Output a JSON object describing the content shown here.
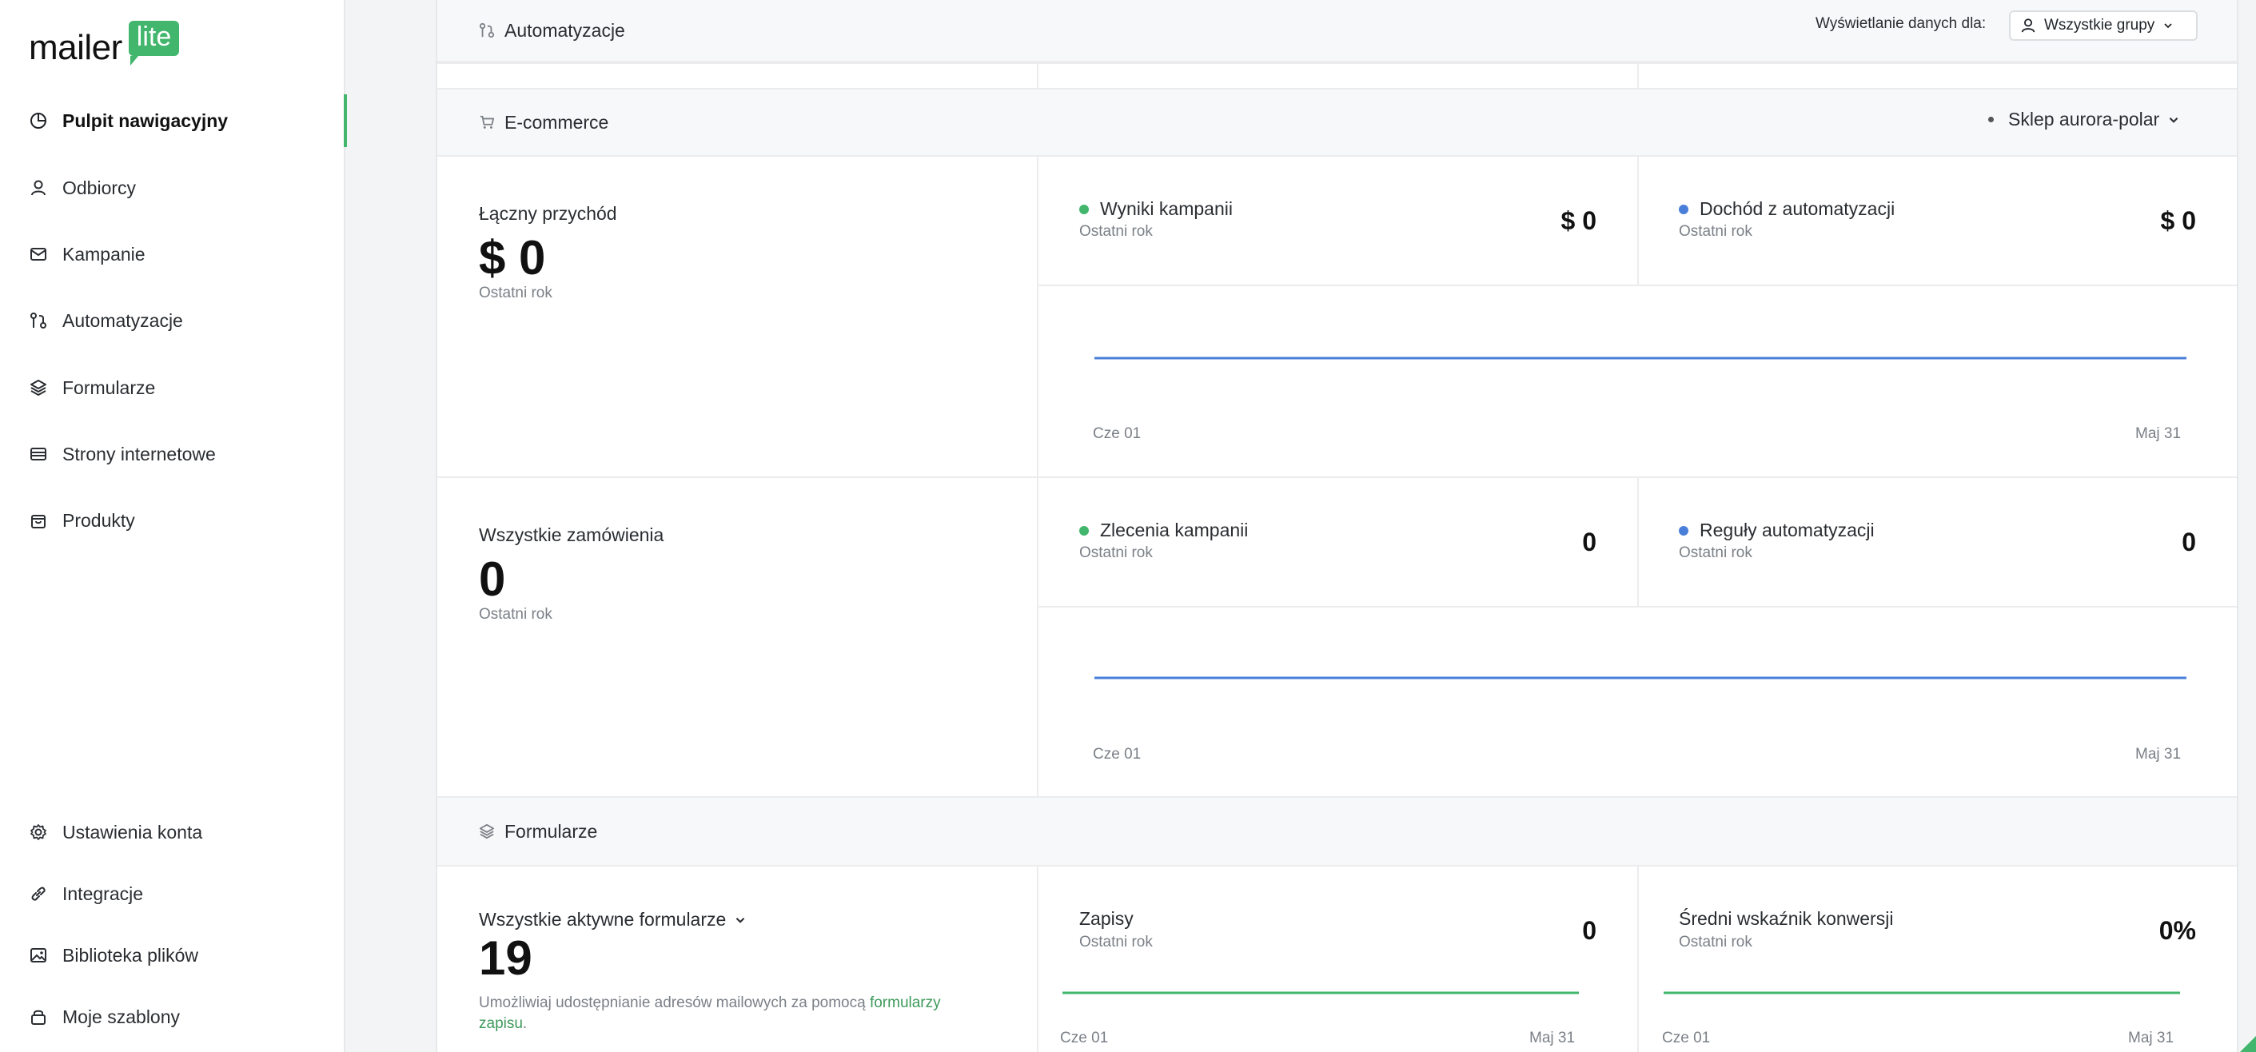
{
  "brand": {
    "word": "mailer",
    "badge": "lite",
    "accent": "#41b66c"
  },
  "sidebar": {
    "items": [
      {
        "label": "Pulpit nawigacyjny",
        "icon": "dashboard-icon",
        "active": true
      },
      {
        "label": "Odbiorcy",
        "icon": "user-icon"
      },
      {
        "label": "Kampanie",
        "icon": "mail-icon"
      },
      {
        "label": "Automatyzacje",
        "icon": "automation-icon"
      },
      {
        "label": "Formularze",
        "icon": "layers-icon"
      },
      {
        "label": "Strony internetowe",
        "icon": "website-icon"
      },
      {
        "label": "Produkty",
        "icon": "bag-icon"
      }
    ],
    "bottom_items": [
      {
        "label": "Ustawienia konta",
        "icon": "gear-icon"
      },
      {
        "label": "Integracje",
        "icon": "link-icon"
      },
      {
        "label": "Biblioteka plików",
        "icon": "image-icon"
      },
      {
        "label": "Moje szablony",
        "icon": "lock-icon"
      }
    ]
  },
  "automations": {
    "title": "Automatyzacje",
    "filter_label": "Wyświetlanie danych dla:",
    "filter_value": "Wszystkie grupy"
  },
  "ecommerce": {
    "title": "E-commerce",
    "store": "Sklep aurora-polar",
    "revenue": {
      "label": "Łączny przychód",
      "value": "$ 0",
      "period": "Ostatni rok",
      "metrics": [
        {
          "title": "Wyniki kampanii",
          "period": "Ostatni rok",
          "value": "$ 0",
          "color": "#41b66c"
        },
        {
          "title": "Dochód z automatyzacji",
          "period": "Ostatni rok",
          "value": "$ 0",
          "color": "#4a7fd9"
        }
      ],
      "axis_start": "Cze 01",
      "axis_end": "Maj 31"
    },
    "orders": {
      "label": "Wszystkie zamówienia",
      "value": "0",
      "period": "Ostatni rok",
      "metrics": [
        {
          "title": "Zlecenia kampanii",
          "period": "Ostatni rok",
          "value": "0",
          "color": "#41b66c"
        },
        {
          "title": "Reguły automatyzacji",
          "period": "Ostatni rok",
          "value": "0",
          "color": "#4a7fd9"
        }
      ],
      "axis_start": "Cze 01",
      "axis_end": "Maj 31"
    }
  },
  "forms": {
    "title": "Formularze",
    "select_label": "Wszystkie aktywne formularze",
    "count": "19",
    "desc_text": "Umożliwiaj udostępnianie adresów mailowych za pomocą ",
    "desc_link": "formularzy zapisu",
    "desc_end": ".",
    "signups": {
      "title": "Zapisy",
      "period": "Ostatni rok",
      "value": "0",
      "axis_start": "Cze 01",
      "axis_end": "Maj 31"
    },
    "conversion": {
      "title": "Średni wskaźnik konwersji",
      "period": "Ostatni rok",
      "value": "0%",
      "axis_start": "Cze 01",
      "axis_end": "Maj 31"
    }
  },
  "chart_data": [
    {
      "type": "line",
      "x": [
        "Cze 01",
        "Maj 31"
      ],
      "series": [
        {
          "values": [
            0,
            0
          ]
        }
      ]
    },
    {
      "type": "line",
      "x": [
        "Cze 01",
        "Maj 31"
      ],
      "series": [
        {
          "values": [
            0,
            0
          ]
        }
      ]
    },
    {
      "type": "line",
      "x": [
        "Cze 01",
        "Maj 31"
      ],
      "series": [
        {
          "values": [
            0,
            0
          ]
        }
      ]
    },
    {
      "type": "line",
      "x": [
        "Cze 01",
        "Maj 31"
      ],
      "series": [
        {
          "values": [
            0,
            0
          ]
        }
      ]
    }
  ]
}
